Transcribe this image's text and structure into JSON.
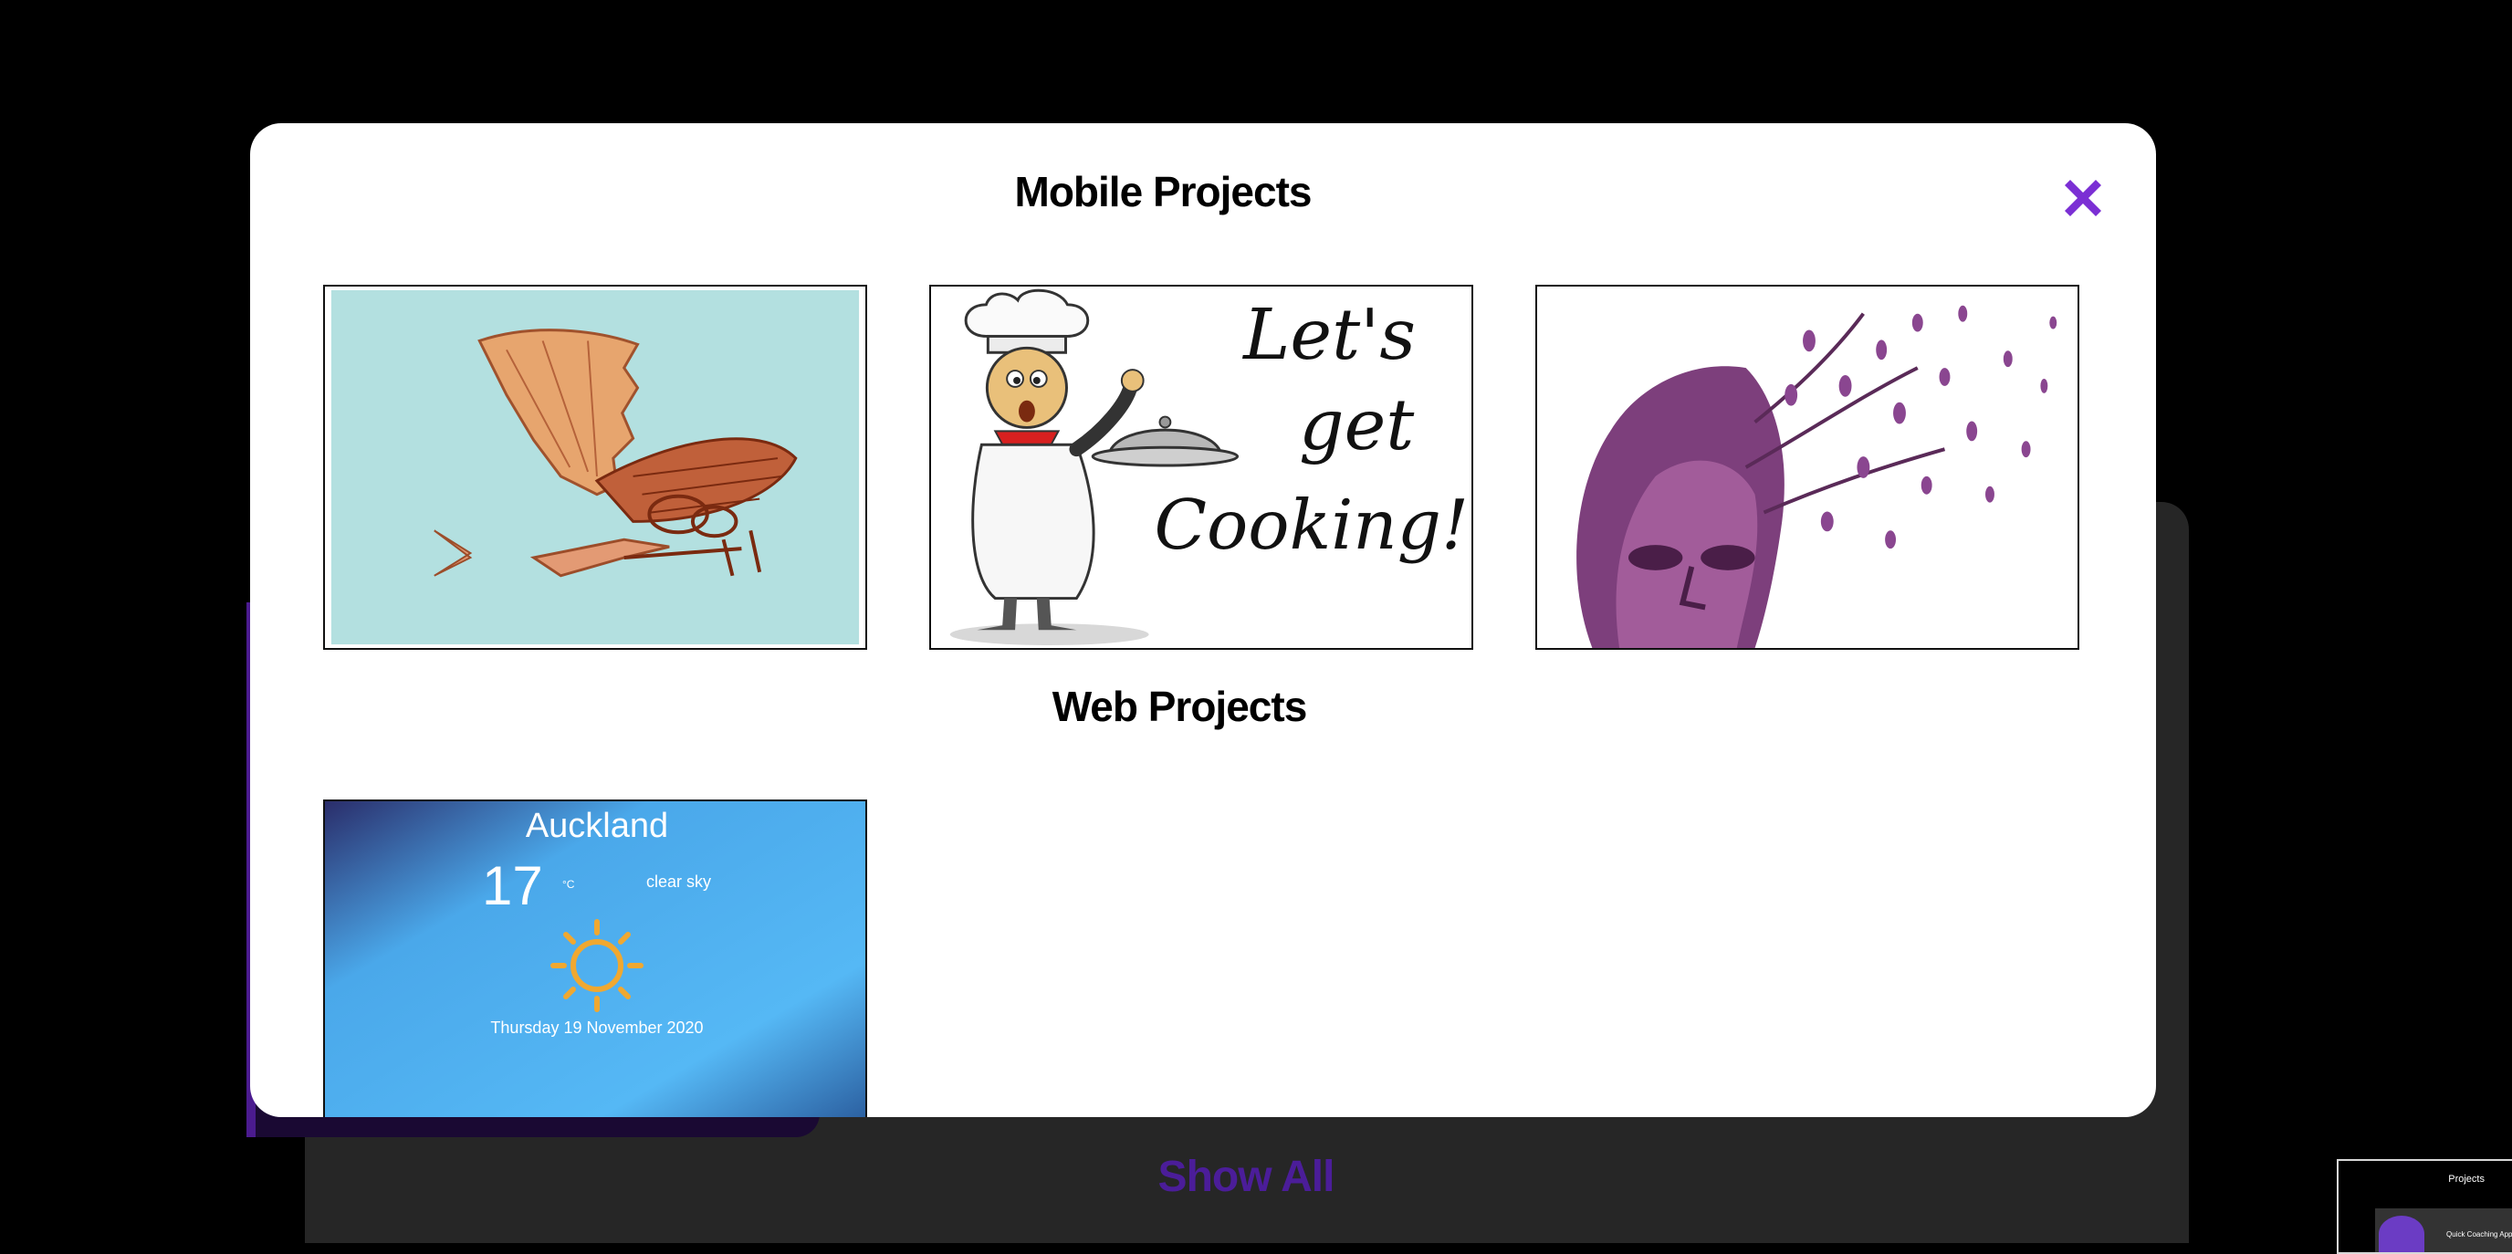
{
  "background": {
    "show_all_label": "Show All",
    "mini_preview": {
      "title": "Projects",
      "caption": "Quick Coaching App"
    }
  },
  "modal": {
    "title": "Mobile Projects",
    "close_icon": "close-x-icon",
    "accent_color": "#7b2fd4",
    "mobile_projects": [
      {
        "image": "flying-machine-sketch"
      },
      {
        "image": "chef-lets-get-cooking"
      },
      {
        "image": "leaf-face-dispersing"
      }
    ],
    "web_section_title": "Web Projects",
    "web_projects": [
      {
        "image": "weather-app-screenshot",
        "weather": {
          "city": "Auckland",
          "temperature": "17",
          "unit": "°C",
          "description": "clear sky",
          "date": "Thursday 19 November 2020"
        }
      }
    ]
  },
  "cooking_card_text": "Let's get Cooking!"
}
